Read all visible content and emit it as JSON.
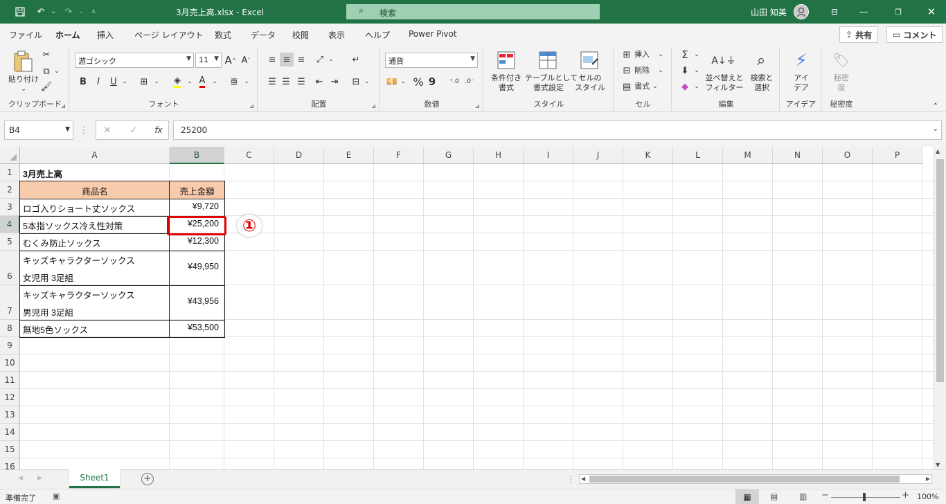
{
  "titlebar": {
    "filename": "3月売上高.xlsx",
    "separator": "-",
    "app": "Excel",
    "search_placeholder": "検索",
    "user": "山田 知美"
  },
  "menu_tabs": [
    "ファイル",
    "ホーム",
    "挿入",
    "ページ レイアウト",
    "数式",
    "データ",
    "校閲",
    "表示",
    "ヘルプ",
    "Power Pivot"
  ],
  "active_tab": "ホーム",
  "share_button": "共有",
  "comment_button": "コメント",
  "ribbon": {
    "clipboard": {
      "paste_label": "貼り付け",
      "group": "クリップボード"
    },
    "font": {
      "font_name": "游ゴシック",
      "font_size": "11",
      "group": "フォント",
      "bold": "B",
      "italic": "I",
      "underline": "U"
    },
    "alignment": {
      "group": "配置"
    },
    "number": {
      "format": "通貨",
      "group": "数値",
      "percent": "%",
      "comma": "9"
    },
    "styles": {
      "conditional": "条件付き\n書式",
      "table": "テーブルとして\n書式設定",
      "cell": "セルの\nスタイル",
      "group": "スタイル"
    },
    "cells": {
      "insert": "挿入",
      "delete": "削除",
      "format": "書式",
      "group": "セル"
    },
    "editing": {
      "sort": "並べ替えと\nフィルター",
      "find": "検索と\n選択",
      "group": "編集"
    },
    "ideas": {
      "label": "アイ\nデア",
      "group": "アイデア"
    },
    "sensitivity": {
      "label": "秘密\n度",
      "group": "秘密度"
    }
  },
  "formula_bar": {
    "name_box": "B4",
    "fx": "fx",
    "value": "25200"
  },
  "columns": [
    "A",
    "B",
    "C",
    "D",
    "E",
    "F",
    "G",
    "H",
    "I",
    "J",
    "K",
    "L",
    "M",
    "N",
    "O",
    "P"
  ],
  "rows": [
    "1",
    "2",
    "3",
    "4",
    "5",
    "6",
    "7",
    "8",
    "9",
    "10",
    "11",
    "12",
    "13",
    "14",
    "15",
    "16"
  ],
  "sheet": {
    "title": "3月売上高",
    "header_product": "商品名",
    "header_sales": "売上金額",
    "items": [
      {
        "name": "ロゴ入りショート丈ソックス",
        "amount": "¥9,720"
      },
      {
        "name": "5本指ソックス冷え性対策",
        "amount": "¥25,200"
      },
      {
        "name": "むくみ防止ソックス",
        "amount": "¥12,300"
      },
      {
        "name": "キッズキャラクターソックス",
        "name2": "女児用 3足組",
        "amount": "¥49,950"
      },
      {
        "name": "キッズキャラクターソックス",
        "name2": "男児用 3足組",
        "amount": "¥43,956"
      },
      {
        "name": "無地5色ソックス",
        "amount": "¥53,500"
      }
    ]
  },
  "annotation": "①",
  "sheet_tab": "Sheet1",
  "status": {
    "ready": "準備完了",
    "zoom": "100%"
  },
  "colors": {
    "excel_green": "#217346",
    "header_fill": "#f8cbad",
    "highlight": "#e00000"
  }
}
